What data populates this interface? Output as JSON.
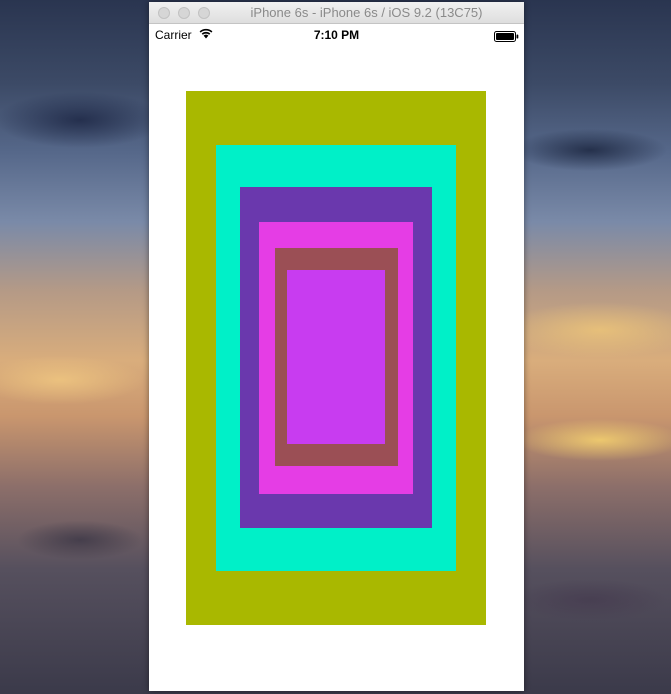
{
  "window": {
    "title": "iPhone 6s - iPhone 6s / iOS 9.2 (13C75)"
  },
  "status_bar": {
    "carrier": "Carrier",
    "time": "7:10 PM",
    "icons": [
      "wifi-icon",
      "battery-icon"
    ]
  },
  "nested_rects": [
    {
      "name": "olive",
      "color": "#a9b800"
    },
    {
      "name": "cyan",
      "color": "#00f0c8"
    },
    {
      "name": "purple",
      "color": "#6a38ad"
    },
    {
      "name": "magenta",
      "color": "#e53de5"
    },
    {
      "name": "brown",
      "color": "#9b4f55"
    },
    {
      "name": "violet",
      "color": "#c83cf0"
    }
  ],
  "colors": {
    "screen_background": "#ffffff",
    "titlebar_text": "#8a8a8a"
  }
}
